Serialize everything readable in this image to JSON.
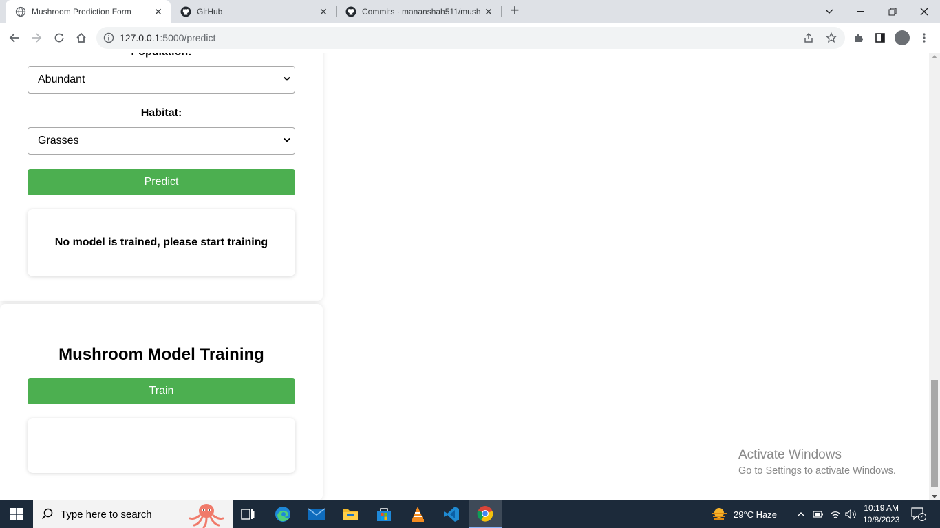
{
  "browser": {
    "tabs": [
      {
        "title": "Mushroom Prediction Form",
        "active": true,
        "icon": "globe-icon"
      },
      {
        "title": "GitHub",
        "active": false,
        "icon": "github-icon"
      },
      {
        "title": "Commits · mananshah511/mush",
        "active": false,
        "icon": "github-icon"
      }
    ],
    "url_host": "127.0.0.1",
    "url_path": ":5000/predict"
  },
  "page": {
    "population_label": "Population:",
    "population_value": "Abundant",
    "habitat_label": "Habitat:",
    "habitat_value": "Grasses",
    "predict_label": "Predict",
    "prediction_result": "No model is trained, please start training",
    "training_heading": "Mushroom Model Training",
    "train_label": "Train",
    "training_result": ""
  },
  "watermark": {
    "line1": "Activate Windows",
    "line2": "Go to Settings to activate Windows."
  },
  "taskbar": {
    "search_placeholder": "Type here to search",
    "weather": "29°C  Haze",
    "time": "10:19 AM",
    "date": "10/8/2023",
    "notification_count": "2"
  },
  "colors": {
    "accent_green": "#4caf50",
    "taskbar_bg": "#1c2a3a"
  }
}
